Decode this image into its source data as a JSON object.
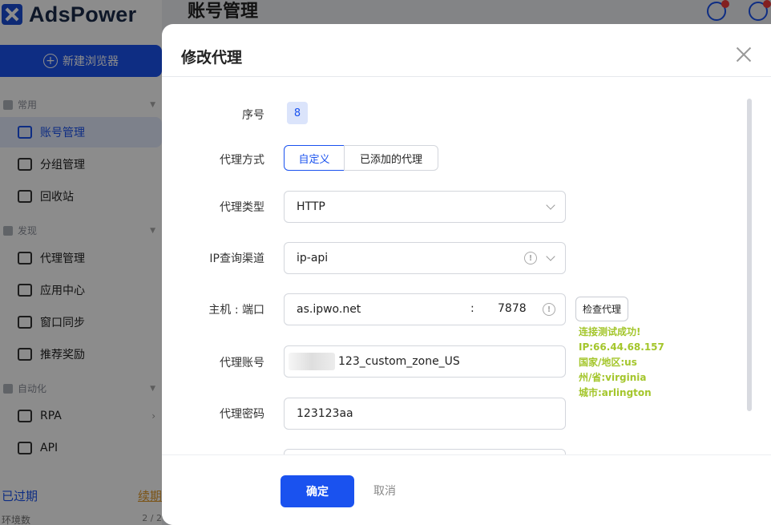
{
  "app": {
    "logo_text": "AdsPower",
    "page_title": "账号管理"
  },
  "sidebar": {
    "new_browser": "新建浏览器",
    "sections": [
      {
        "label": "常用"
      },
      {
        "label": "发现"
      },
      {
        "label": "自动化"
      }
    ],
    "items": [
      {
        "label": "账号管理",
        "icon": "folder-icon",
        "active": true
      },
      {
        "label": "分组管理",
        "icon": "folder-open-icon"
      },
      {
        "label": "回收站",
        "icon": "trash-icon"
      },
      {
        "label": "代理管理",
        "icon": "proxy-icon"
      },
      {
        "label": "应用中心",
        "icon": "puzzle-icon"
      },
      {
        "label": "窗口同步",
        "icon": "sync-window-icon"
      },
      {
        "label": "推荐奖励",
        "icon": "gear-star-icon"
      },
      {
        "label": "RPA",
        "icon": "robot-icon"
      },
      {
        "label": "API",
        "icon": "plug-icon"
      }
    ],
    "expired": "已过期",
    "renew": "续期",
    "env_label": "环境数",
    "env_value": "2 / 2"
  },
  "modal": {
    "title": "修改代理",
    "labels": {
      "seq": "序号",
      "proxy_mode": "代理方式",
      "proxy_type": "代理类型",
      "ip_channel": "IP查询渠道",
      "host_port": "主机 : 端口",
      "account": "代理账号",
      "password": "代理密码"
    },
    "seq_value": "8",
    "proxy_mode": {
      "custom": "自定义",
      "added": "已添加的代理"
    },
    "proxy_type_value": "HTTP",
    "ip_channel_value": "ip-api",
    "host_value": "as.ipwo.net",
    "port_separator": ":",
    "port_value": "7878",
    "check_button": "检查代理",
    "test_result": [
      "连接测试成功!",
      "IP:66.44.68.157",
      "国家/地区:us",
      "州/省:virginia",
      "城市:arlington"
    ],
    "account_value": "123_custom_zone_US",
    "password_value": "123123aa",
    "ok_button": "确定",
    "cancel_button": "取消",
    "colors": {
      "primary": "#1a52ef",
      "success": "#a4c62c"
    }
  }
}
